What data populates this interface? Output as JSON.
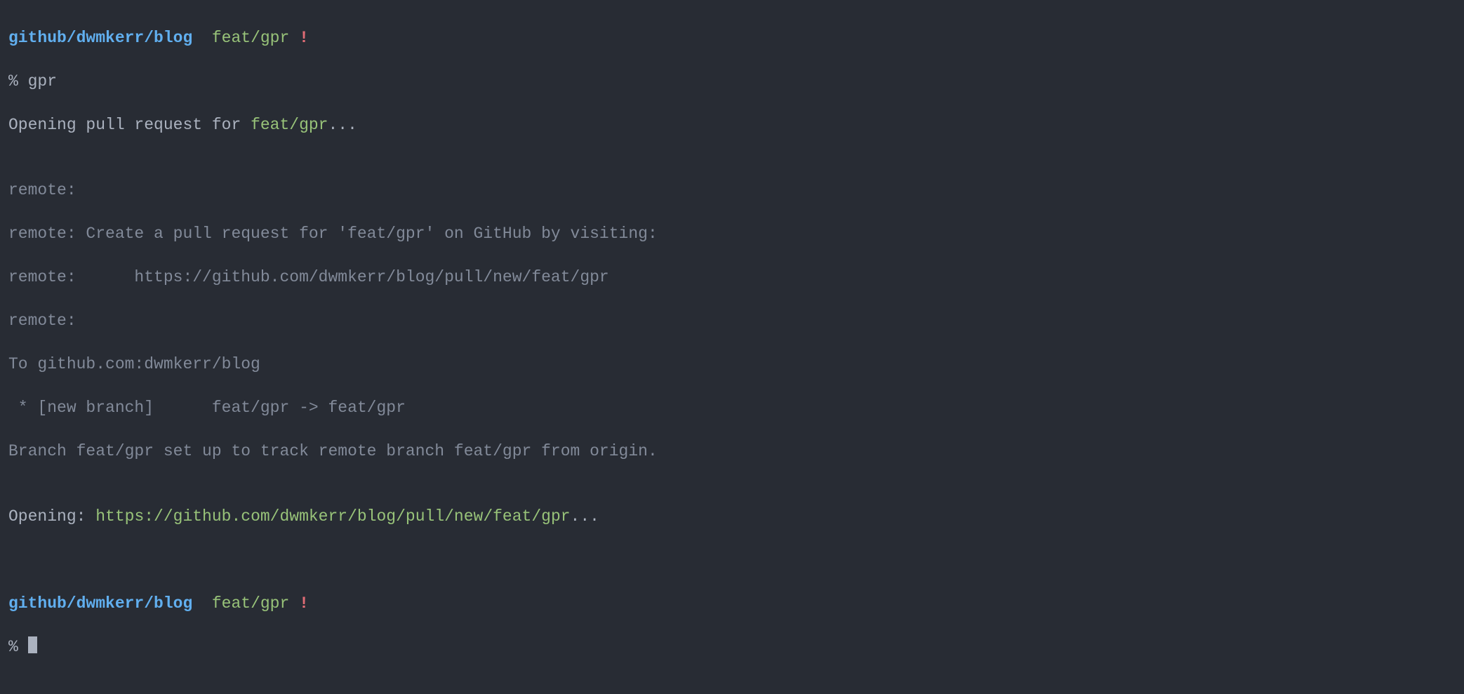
{
  "prompt1": {
    "path": "github/dwmkerr/blog",
    "sep1": "  ",
    "branch": "feat/gpr",
    "sep2": " ",
    "bang": "!"
  },
  "cmd1": {
    "sigil": "% ",
    "text": "gpr"
  },
  "open_pr": {
    "pre": "Opening pull request for ",
    "branch": "feat/gpr",
    "post": "..."
  },
  "blank": "",
  "remote": {
    "l1": "remote:",
    "l2": "remote: Create a pull request for 'feat/gpr' on GitHub by visiting:",
    "l3": "remote:      https://github.com/dwmkerr/blog/pull/new/feat/gpr",
    "l4": "remote:"
  },
  "push": {
    "to": "To github.com:dwmkerr/blog",
    "newbranch": " * [new branch]      feat/gpr -> feat/gpr",
    "track": "Branch feat/gpr set up to track remote branch feat/gpr from origin."
  },
  "opening": {
    "pre": "Opening: ",
    "url": "https://github.com/dwmkerr/blog/pull/new/feat/gpr",
    "post": "..."
  },
  "prompt2": {
    "path": "github/dwmkerr/blog",
    "sep1": "  ",
    "branch": "feat/gpr",
    "sep2": " ",
    "bang": "!"
  },
  "cmd2": {
    "sigil": "% "
  }
}
